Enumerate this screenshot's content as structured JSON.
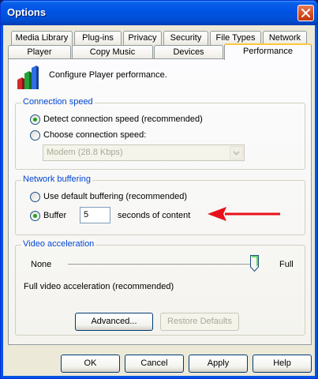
{
  "window": {
    "title": "Options"
  },
  "tabs": {
    "top": [
      "Media Library",
      "Plug-ins",
      "Privacy",
      "Security",
      "File Types",
      "Network"
    ],
    "bottom": [
      "Player",
      "Copy Music",
      "Devices",
      "Performance"
    ],
    "active": "Performance"
  },
  "header": {
    "text": "Configure Player performance."
  },
  "connection_speed": {
    "label": "Connection speed",
    "option_detect": "Detect connection speed (recommended)",
    "option_choose": "Choose connection speed:",
    "selected": "detect",
    "speed_select": "Modem (28.8 Kbps)"
  },
  "network_buffering": {
    "label": "Network buffering",
    "option_default": "Use default buffering (recommended)",
    "option_buffer": "Buffer",
    "buffer_value": "5",
    "buffer_suffix": "seconds of content",
    "selected": "buffer"
  },
  "video_acceleration": {
    "label": "Video acceleration",
    "min_label": "None",
    "max_label": "Full",
    "level": 1.0,
    "status": "Full video acceleration (recommended)"
  },
  "panel_buttons": {
    "advanced": "Advanced...",
    "restore": "Restore Defaults"
  },
  "dialog_buttons": {
    "ok": "OK",
    "cancel": "Cancel",
    "apply": "Apply",
    "help": "Help"
  },
  "colors": {
    "accent_arrow": "#e8111a",
    "titlebar": "#0054e3",
    "group_label": "#0046d5"
  }
}
